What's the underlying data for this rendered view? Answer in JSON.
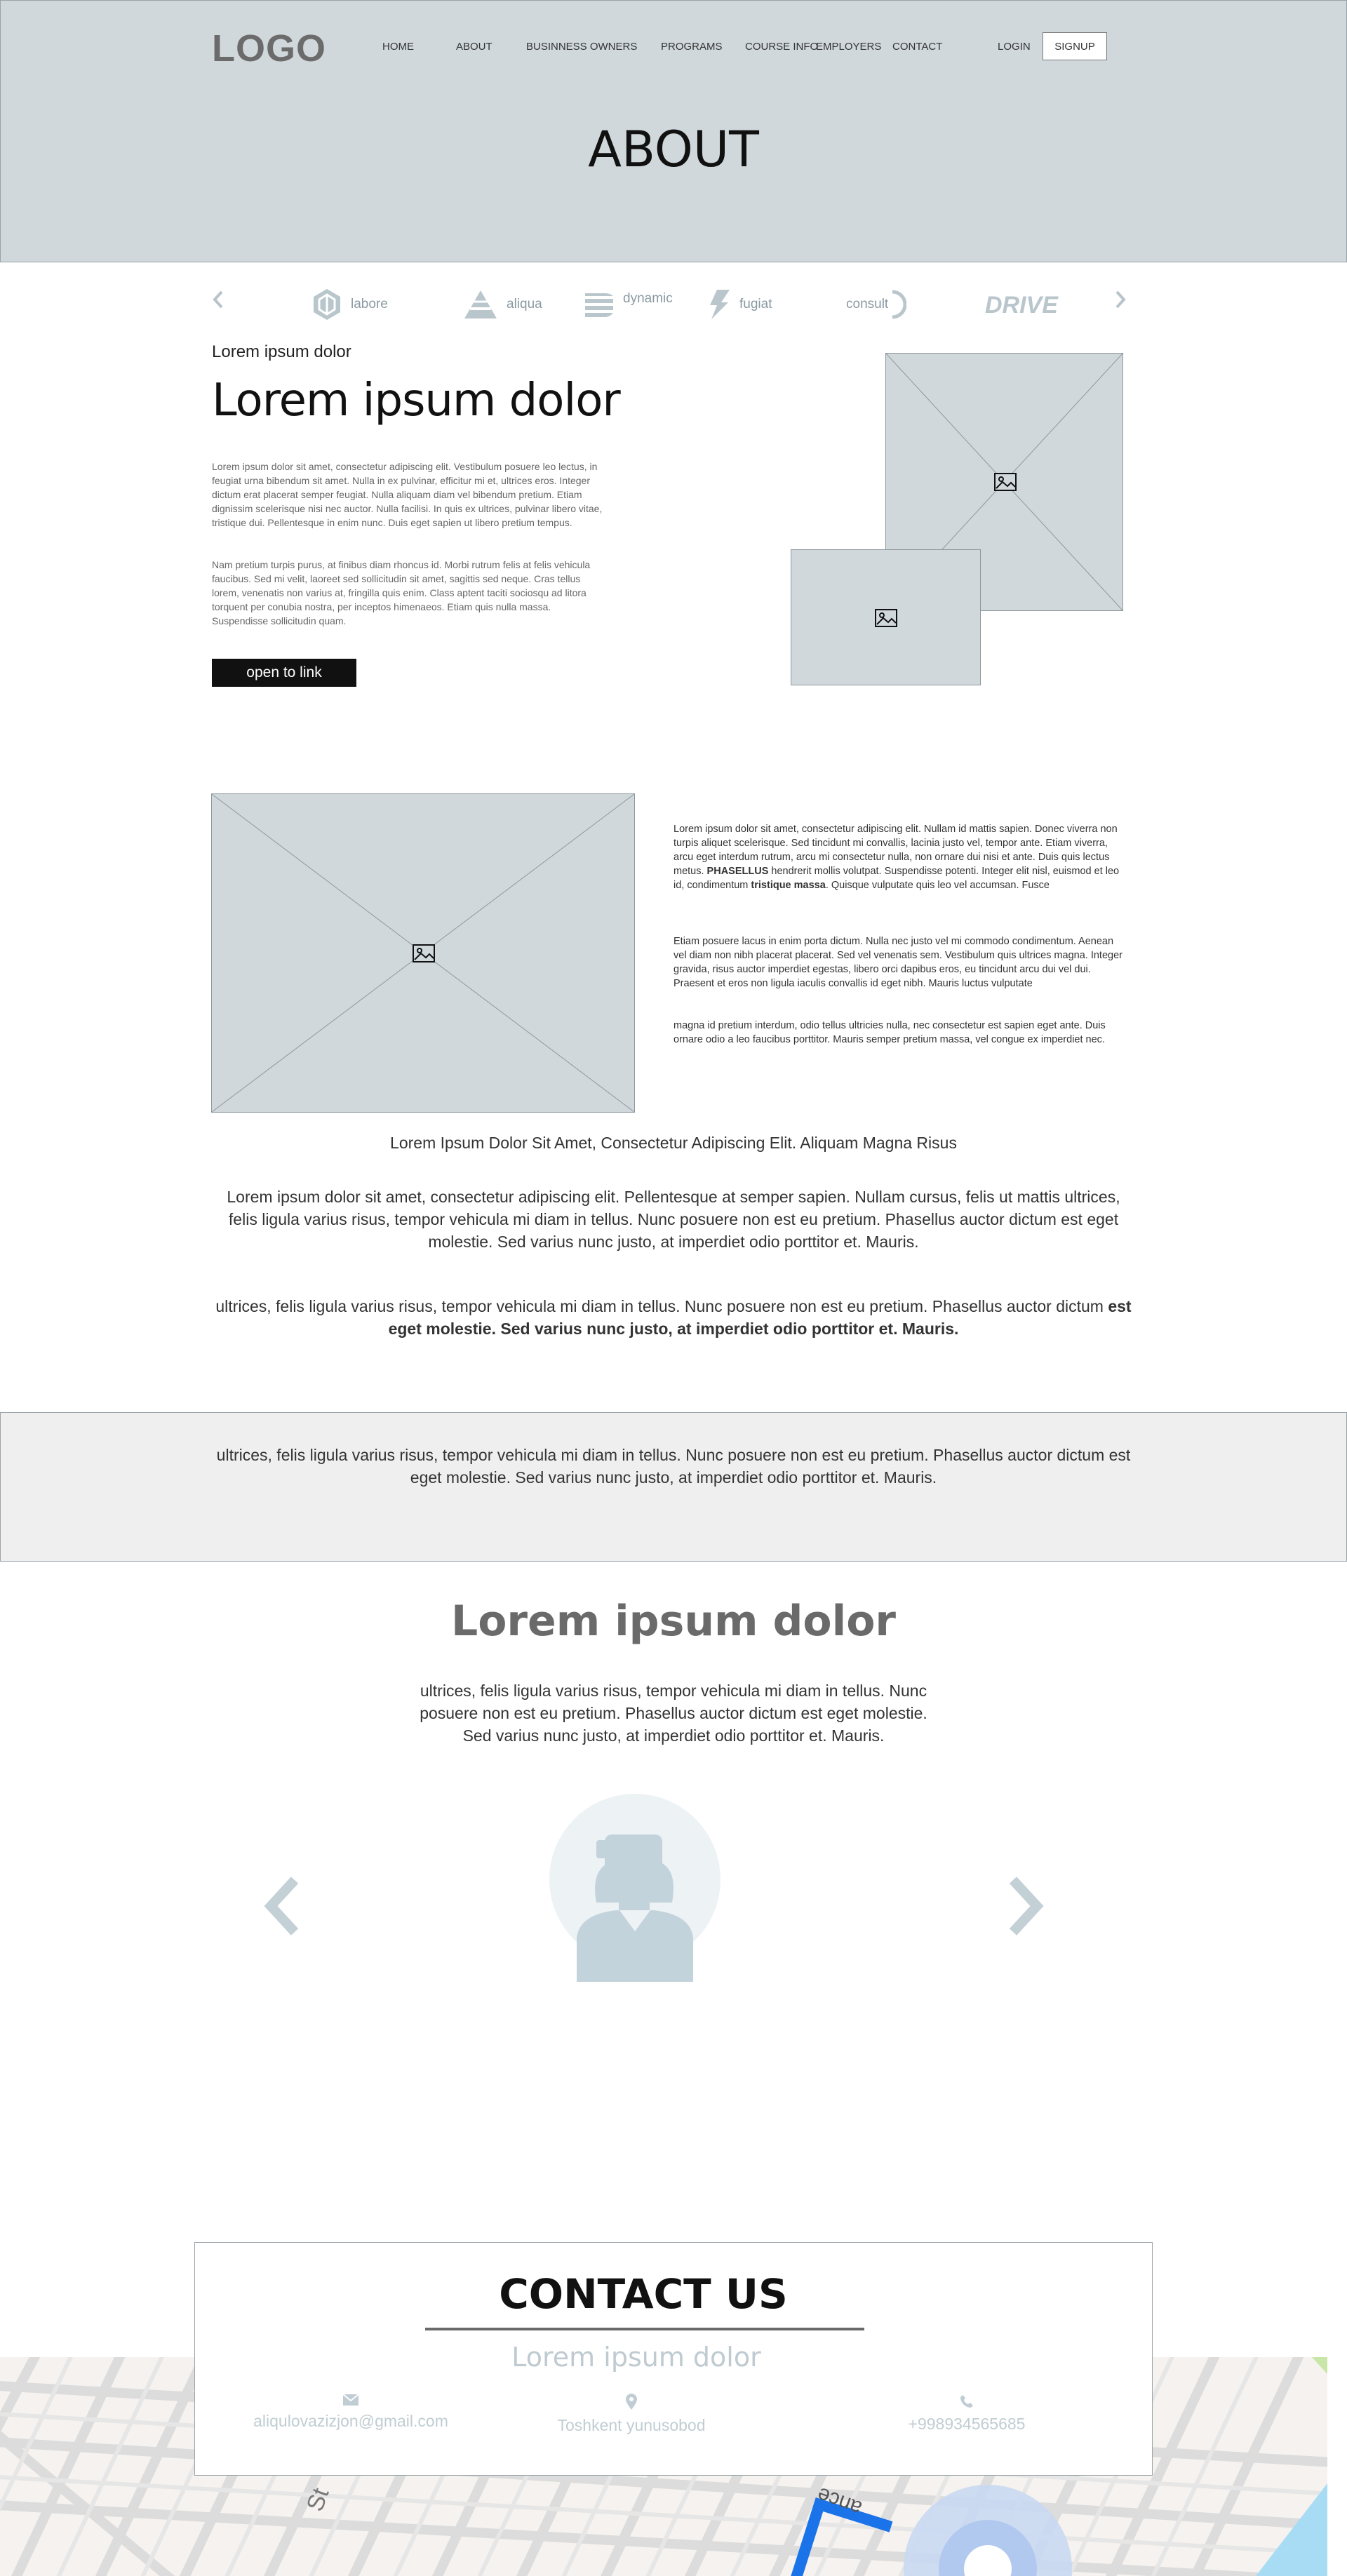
{
  "header": {
    "logo": "LOGO",
    "nav": [
      "HOME",
      "ABOUT",
      "BUSINNESS OWNERS",
      "PROGRAMS",
      "COURSE INFO",
      "EMPLOYERS",
      "CONTACT"
    ],
    "login": "LOGIN",
    "signup": "SIGNUP",
    "page_title": "ABOUT"
  },
  "brands": [
    {
      "name": "labore",
      "icon": "hexagon-logo-icon"
    },
    {
      "name": "aliqua",
      "icon": "triangle-logo-icon"
    },
    {
      "name": "dynamic",
      "icon": "stripes-logo-icon"
    },
    {
      "name": "fugiat",
      "icon": "bolt-logo-icon"
    },
    {
      "name": "consult",
      "icon": "arc-logo-icon"
    },
    {
      "name": "DRIVE",
      "icon": "drive-wordmark-icon"
    }
  ],
  "section1": {
    "eyebrow": "Lorem ipsum dolor",
    "title": "Lorem ipsum dolor",
    "p1": "Lorem ipsum dolor sit amet, consectetur adipiscing elit. Vestibulum posuere leo lectus, in feugiat urna bibendum sit amet. Nulla in ex pulvinar, efficitur mi et, ultrices eros. Integer dictum erat placerat semper feugiat. Nulla aliquam diam vel bibendum pretium. Etiam dignissim scelerisque nisi nec auctor. Nulla facilisi. In quis ex ultrices, pulvinar libero vitae, tristique dui. Pellentesque in enim nunc. Duis eget sapien ut libero pretium tempus.",
    "p2": "Nam pretium turpis purus, at finibus diam rhoncus id. Morbi rutrum felis at felis vehicula faucibus. Sed mi velit, laoreet sed sollicitudin sit amet, sagittis sed neque. Cras tellus lorem, venenatis non varius at, fringilla quis enim. Class aptent taciti sociosqu ad litora torquent per conubia nostra, per inceptos himenaeos. Etiam quis nulla massa. Suspendisse sollicitudin quam.",
    "button": "open to link"
  },
  "section2": {
    "p1_a": "Lorem ipsum dolor sit amet, consectetur adipiscing elit. Nullam id mattis sapien. Donec viverra non turpis aliquet scelerisque. Sed tincidunt mi convallis, lacinia justo vel, tempor ante. Etiam viverra, arcu eget interdum rutrum, arcu mi consectetur nulla, non ornare dui nisi et ante. Duis quis lectus metus.",
    "p1_bold1": "PHASELLUS",
    "p1_b": "hendrerit mollis volutpat. Suspendisse potenti. Integer elit nisl, euismod et leo id, condimentum",
    "p1_bold2": "tristique massa",
    "p1_c": ". Quisque vulputate quis leo vel accumsan. Fusce",
    "p2": "Etiam posuere lacus in enim porta dictum. Nulla nec justo vel mi commodo condimentum. Aenean vel diam non nibh placerat placerat. Sed vel venenatis sem. Vestibulum quis ultrices magna. Integer gravida, risus auctor imperdiet egestas, libero orci dapibus eros, eu tincidunt arcu dui vel dui. Praesent et eros non ligula iaculis convallis id eget nibh. Mauris luctus vulputate",
    "p3": "magna id pretium interdum, odio tellus ultricies nulla, nec consectetur est sapien eget ante. Duis ornare odio a leo faucibus porttitor. Mauris semper pretium massa, vel congue ex imperdiet nec."
  },
  "section3": {
    "subtitle": "Lorem Ipsum Dolor Sit Amet, Consectetur Adipiscing Elit. Aliquam Magna Risus",
    "p1": "Lorem ipsum dolor sit amet, consectetur adipiscing elit. Pellentesque at semper sapien. Nullam cursus, felis ut mattis ultrices, felis ligula varius risus, tempor vehicula mi diam in tellus. Nunc posuere non est eu pretium. Phasellus auctor dictum est eget molestie. Sed varius nunc justo, at imperdiet odio porttitor et. Mauris.",
    "p2_a": "ultrices, felis ligula varius risus, tempor vehicula mi diam in tellus. Nunc posuere non est eu pretium. Phasellus auctor dictum",
    "p2_bold": "est eget molestie. Sed varius nunc justo, at imperdiet odio porttitor et. Mauris."
  },
  "band": {
    "text": "ultrices, felis ligula varius risus, tempor vehicula mi diam in tellus. Nunc posuere non est eu pretium. Phasellus auctor dictum est eget molestie. Sed varius nunc justo, at imperdiet odio porttitor et. Mauris."
  },
  "testimonials": {
    "title": "Lorem ipsum dolor",
    "text": "ultrices, felis ligula varius risus, tempor vehicula mi diam in tellus. Nunc posuere non est eu pretium. Phasellus auctor dictum est eget molestie. Sed varius nunc justo, at imperdiet odio porttitor et. Mauris."
  },
  "map": {
    "label_a": "St",
    "label_b": "ance"
  },
  "contact": {
    "title": "CONTACT US",
    "subtitle": "Lorem ipsum dolor",
    "email": "aliqulovazizjon@gmail.com",
    "address": "Toshkent yunusobod",
    "phone": "+998934565685"
  },
  "colors": {
    "header_bg": "#d0d8dc",
    "placeholder_bg": "#d0d8dc",
    "button_bg": "#111111",
    "band_bg": "#efefef",
    "accent_muted": "#bfcbd1",
    "map_route": "#1a73e8"
  }
}
